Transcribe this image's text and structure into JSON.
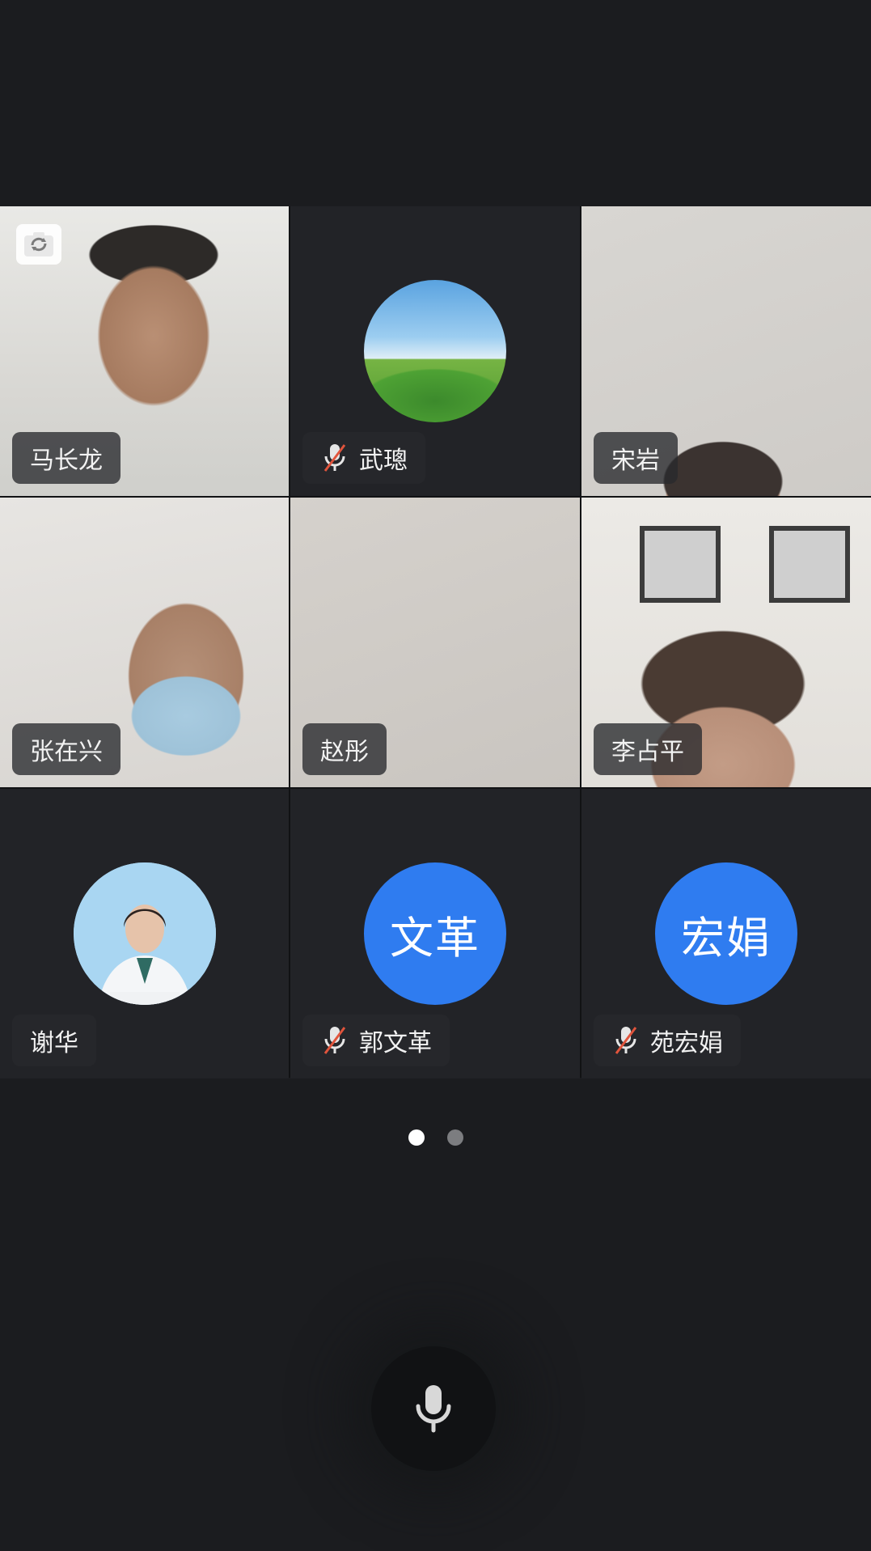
{
  "participants": [
    {
      "name": "马长龙",
      "muted": false,
      "view": "video"
    },
    {
      "name": "武璁",
      "muted": true,
      "view": "avatar-image"
    },
    {
      "name": "宋岩",
      "muted": false,
      "view": "video"
    },
    {
      "name": "张在兴",
      "muted": false,
      "view": "video"
    },
    {
      "name": "赵彤",
      "muted": false,
      "view": "video"
    },
    {
      "name": "李占平",
      "muted": false,
      "view": "video"
    },
    {
      "name": "谢华",
      "muted": false,
      "view": "avatar-image"
    },
    {
      "name": "郭文革",
      "muted": true,
      "view": "avatar-initials",
      "initials": "文革"
    },
    {
      "name": "苑宏娟",
      "muted": true,
      "view": "avatar-initials",
      "initials": "宏娟"
    }
  ],
  "pager": {
    "pages": 2,
    "current": 1
  },
  "colors": {
    "background": "#1b1c1f",
    "tile": "#222327",
    "avatar_blue": "#2f7cf0",
    "mute_slash": "#e0543c",
    "name_tag": "#28292d"
  },
  "icons": {
    "camera_switch": "camera-switch-icon",
    "muted_mic": "mic-muted-icon",
    "microphone": "microphone-icon"
  }
}
